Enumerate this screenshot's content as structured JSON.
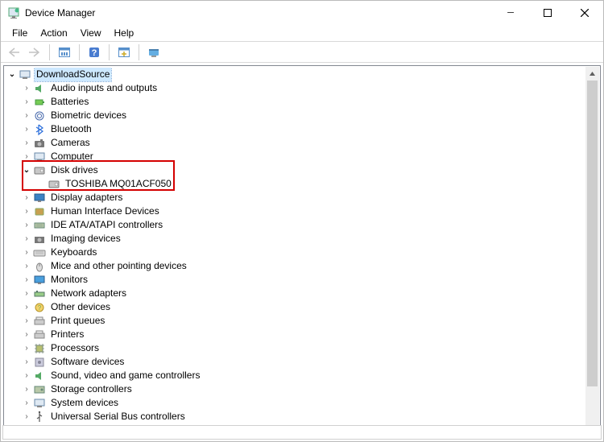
{
  "window": {
    "title": "Device Manager"
  },
  "menus": {
    "file": "File",
    "action": "Action",
    "view": "View",
    "help": "Help"
  },
  "tree": {
    "root": {
      "label": "DownloadSource",
      "expanded": true,
      "selected": true,
      "icon": "computer-root"
    },
    "categories": [
      {
        "label": "Audio inputs and outputs",
        "icon": "audio",
        "expanded": false
      },
      {
        "label": "Batteries",
        "icon": "battery",
        "expanded": false
      },
      {
        "label": "Biometric devices",
        "icon": "biometric",
        "expanded": false
      },
      {
        "label": "Bluetooth",
        "icon": "bluetooth",
        "expanded": false
      },
      {
        "label": "Cameras",
        "icon": "camera",
        "expanded": false
      },
      {
        "label": "Computer",
        "icon": "pc",
        "expanded": false
      },
      {
        "label": "Disk drives",
        "icon": "disk",
        "expanded": true,
        "children": [
          {
            "label": "TOSHIBA MQ01ACF050",
            "icon": "disk"
          }
        ]
      },
      {
        "label": "Display adapters",
        "icon": "display",
        "expanded": false
      },
      {
        "label": "Human Interface Devices",
        "icon": "hid",
        "expanded": false
      },
      {
        "label": "IDE ATA/ATAPI controllers",
        "icon": "ide",
        "expanded": false
      },
      {
        "label": "Imaging devices",
        "icon": "imaging",
        "expanded": false
      },
      {
        "label": "Keyboards",
        "icon": "keyboard",
        "expanded": false
      },
      {
        "label": "Mice and other pointing devices",
        "icon": "mouse",
        "expanded": false
      },
      {
        "label": "Monitors",
        "icon": "monitor",
        "expanded": false
      },
      {
        "label": "Network adapters",
        "icon": "network",
        "expanded": false
      },
      {
        "label": "Other devices",
        "icon": "other",
        "expanded": false
      },
      {
        "label": "Print queues",
        "icon": "printq",
        "expanded": false
      },
      {
        "label": "Printers",
        "icon": "printer",
        "expanded": false
      },
      {
        "label": "Processors",
        "icon": "cpu",
        "expanded": false
      },
      {
        "label": "Software devices",
        "icon": "software",
        "expanded": false
      },
      {
        "label": "Sound, video and game controllers",
        "icon": "sound",
        "expanded": false
      },
      {
        "label": "Storage controllers",
        "icon": "storage",
        "expanded": false
      },
      {
        "label": "System devices",
        "icon": "system",
        "expanded": false
      },
      {
        "label": "Universal Serial Bus controllers",
        "icon": "usb",
        "expanded": false
      }
    ]
  },
  "highlight": {
    "target_category_label": "Disk drives"
  }
}
